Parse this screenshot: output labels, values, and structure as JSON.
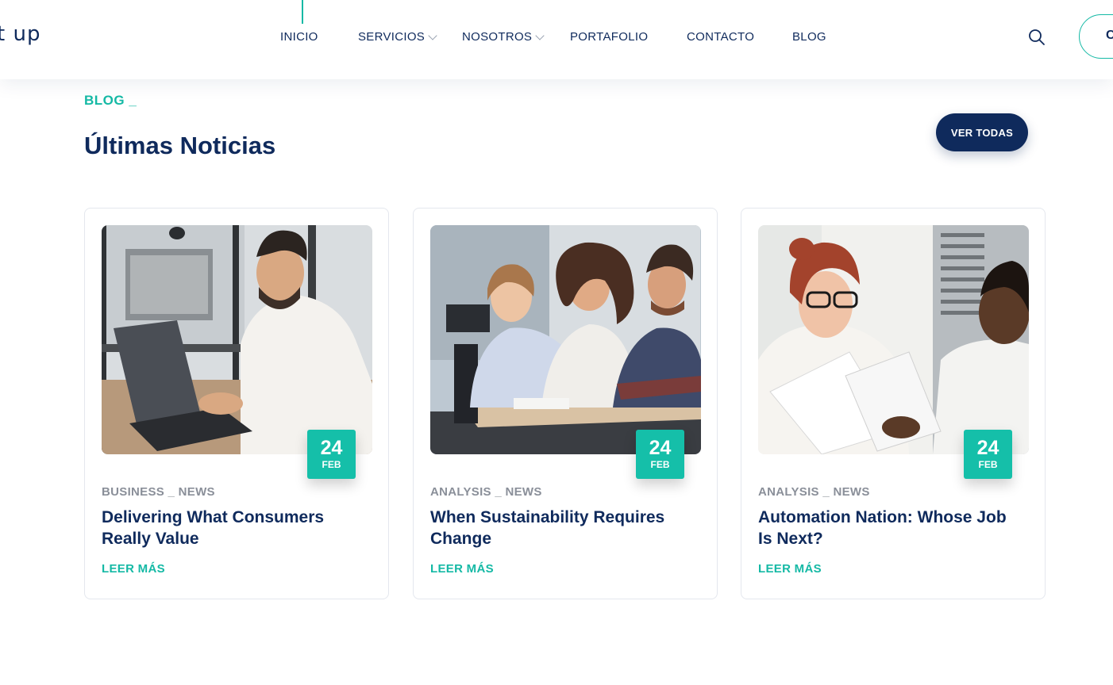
{
  "header": {
    "logo_text": "t up",
    "nav": [
      {
        "label": "INICIO"
      },
      {
        "label": "SERVICIOS"
      },
      {
        "label": "NOSOTROS"
      },
      {
        "label": "PORTAFOLIO"
      },
      {
        "label": "CONTACTO"
      },
      {
        "label": "BLOG"
      }
    ],
    "cta_partial_text": "C"
  },
  "section": {
    "eyebrow": "BLOG _",
    "title": "Últimas Noticias",
    "view_all_label": "VER TODAS"
  },
  "posts": [
    {
      "day": "24",
      "month": "FEB",
      "category": "BUSINESS _ NEWS",
      "title": "Delivering What Consumers Really Value",
      "link": "LEER MÁS"
    },
    {
      "day": "24",
      "month": "FEB",
      "category": "ANALYSIS _ NEWS",
      "title": "When Sustainability Requires Change",
      "link": "LEER MÁS"
    },
    {
      "day": "24",
      "month": "FEB",
      "category": "ANALYSIS _ NEWS",
      "title": "Automation Nation: Whose Job Is Next?",
      "link": "LEER MÁS"
    }
  ],
  "colors": {
    "accent": "#15b9a5",
    "navy": "#0f2a5c",
    "muted": "#8a8f99"
  }
}
